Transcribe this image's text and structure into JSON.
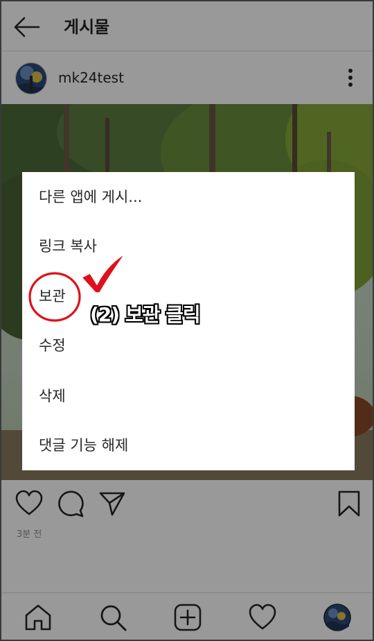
{
  "header": {
    "title": "게시물"
  },
  "post": {
    "username": "mk24test",
    "time": "3분 전"
  },
  "menu": {
    "items": [
      {
        "label": "다른 앱에 게시..."
      },
      {
        "label": "링크 복사"
      },
      {
        "label": "보관"
      },
      {
        "label": "수정"
      },
      {
        "label": "삭제"
      },
      {
        "label": "댓글 기능 해제"
      }
    ]
  },
  "annotation": {
    "text": "(2) 보관 클릭",
    "highlight_color": "#e0101a"
  },
  "icons": [
    "back-arrow-icon",
    "more-vertical-icon",
    "heart-icon",
    "comment-icon",
    "send-icon",
    "bookmark-icon",
    "home-icon",
    "search-icon",
    "add-post-icon",
    "activity-heart-icon",
    "profile-avatar-icon"
  ]
}
